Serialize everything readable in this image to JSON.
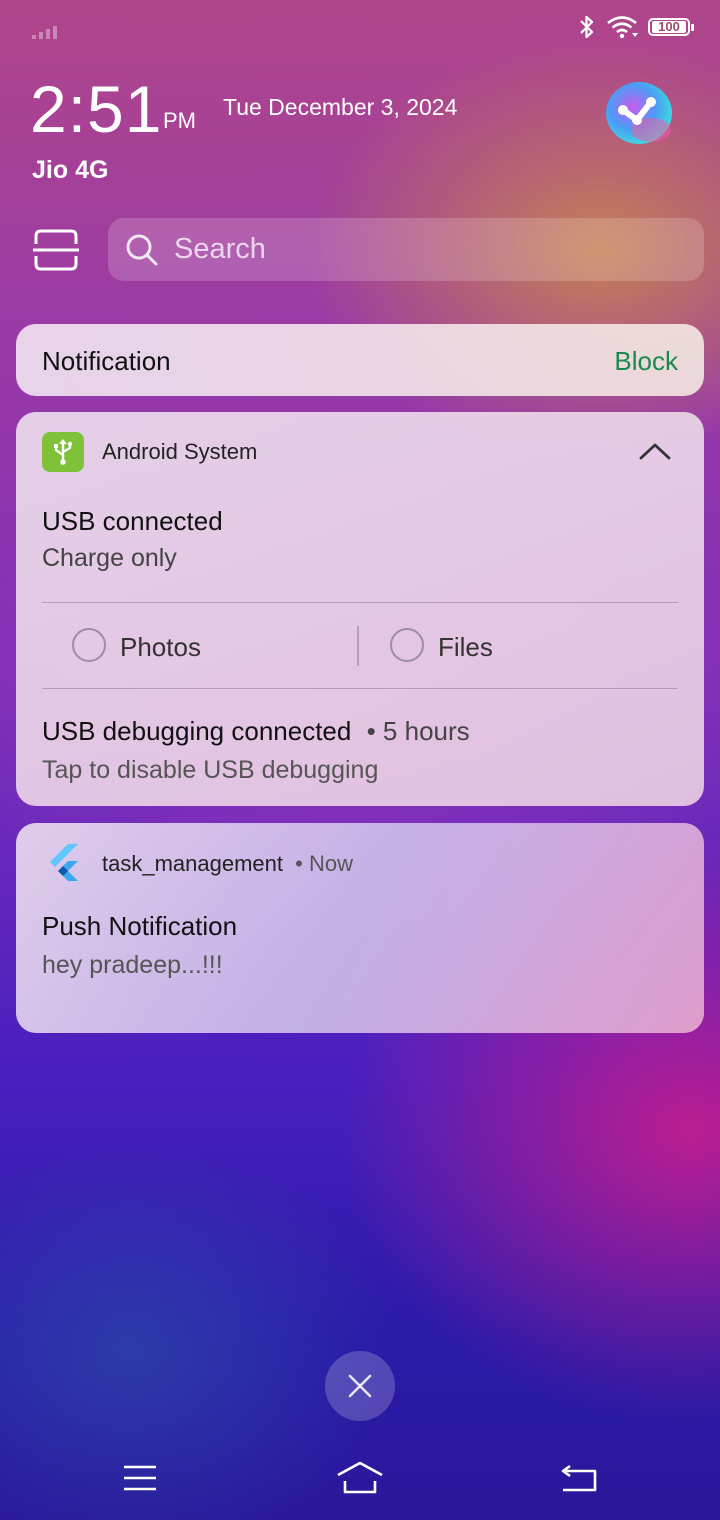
{
  "status_bar": {
    "signal_icon": "signal-bars-icon",
    "bluetooth_icon": "bluetooth-icon",
    "wifi_icon": "wifi-icon",
    "battery_level": "100"
  },
  "header": {
    "time": "2:51",
    "ampm": "PM",
    "date": "Tue December 3, 2024",
    "carrier": "Jio 4G",
    "assistant_icon": "jovi-assistant-icon"
  },
  "search": {
    "scan_icon": "scan-icon",
    "placeholder": "Search"
  },
  "notifications": {
    "block_card": {
      "title": "Notification",
      "action": "Block",
      "action_color": "#1a8a4c"
    },
    "android_system": {
      "app": "Android System",
      "app_icon": "usb-icon",
      "app_icon_color": "#7fc23a",
      "title": "USB connected",
      "subtitle": "Charge only",
      "options": [
        "Photos",
        "Files"
      ],
      "debug_title": "USB debugging connected",
      "debug_time": "• 5 hours",
      "debug_subtitle": "Tap to disable USB debugging"
    },
    "task_management": {
      "app": "task_management",
      "app_icon": "flutter-icon",
      "time": "• Now",
      "title": "Push Notification",
      "body": "hey pradeep...!!!"
    }
  },
  "bottom": {
    "dismiss_icon": "close-icon",
    "nav": [
      "menu-icon",
      "home-icon",
      "back-icon"
    ]
  }
}
